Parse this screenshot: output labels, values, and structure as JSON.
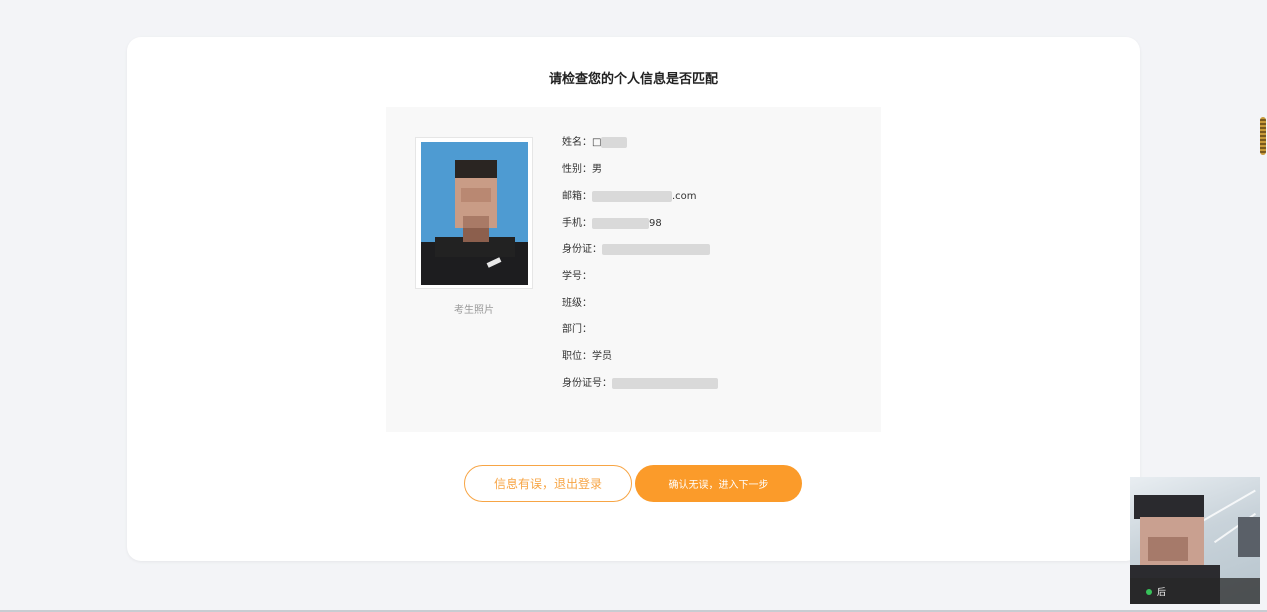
{
  "page": {
    "title": "请检查您的个人信息是否匹配"
  },
  "photo": {
    "caption": "考生照片"
  },
  "fields": {
    "name": {
      "label": "姓名：",
      "value": "□"
    },
    "gender": {
      "label": "性别：",
      "value": "男"
    },
    "email": {
      "label": "邮箱：",
      "value": ".com"
    },
    "phone": {
      "label": "手机：",
      "value": "98"
    },
    "id_card": {
      "label": "身份证：",
      "value": ""
    },
    "student_no": {
      "label": "学号：",
      "value": ""
    },
    "class": {
      "label": "班级：",
      "value": ""
    },
    "department": {
      "label": "部门：",
      "value": ""
    },
    "position": {
      "label": "职位：",
      "value": "学员"
    },
    "id_number": {
      "label": "身份证号：",
      "value": ""
    }
  },
  "buttons": {
    "error": "信息有误，退出登录",
    "confirm": "确认无误，进入下一步"
  },
  "camera": {
    "label": "后"
  },
  "colors": {
    "accent": "#fb9b2a",
    "accent_outline": "#f7a545",
    "background": "#f3f4f7",
    "panel": "#f8f8f8"
  }
}
